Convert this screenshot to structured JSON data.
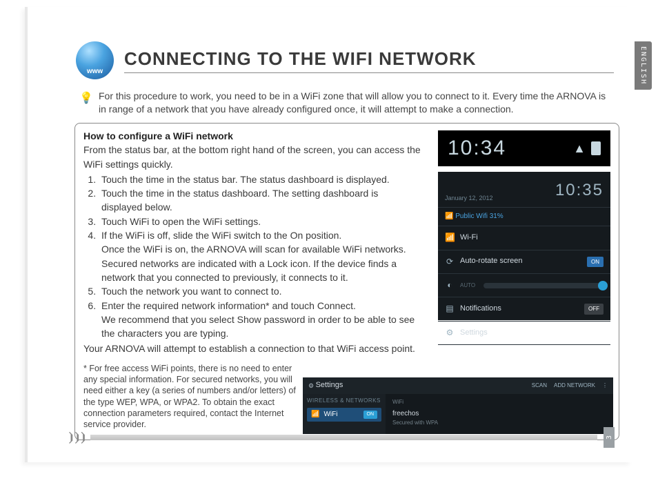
{
  "language_tab": "ENGLISH",
  "header": {
    "globe_label": "www",
    "title": "CONNECTING TO THE WIFI NETWORK"
  },
  "intro": "For this procedure to work, you need to be in a WiFi zone that will allow you to connect to it. Every time the ARNOVA is in range of a network that you have already configured once, it will attempt to make a connection.",
  "config": {
    "heading": "How to configure a WiFi network",
    "lead": "From the status bar, at the bottom right hand of the screen, you can access the WiFi settings quickly.",
    "steps": {
      "s1": "Touch the time in the status bar. The status dashboard is displayed.",
      "s2": "Touch the time in the status dashboard. The setting dashboard is displayed below.",
      "s3": "Touch WiFi to open the WiFi settings.",
      "s4": "If the WiFi is off, slide the WiFi switch to the On position.",
      "s4a": "Once the WiFi is on, the ARNOVA will scan for available WiFi networks.",
      "s4b": "Secured networks are indicated with a Lock icon. If the device finds a network that you connected to previously, it connects to it.",
      "s5": "Touch the network you want to connect to.",
      "s6": "Enter the required network information* and touch Connect.",
      "s6a": "We recommend that you select Show password in order to be able to see the characters you are typing."
    },
    "closing": "Your ARNOVA will attempt to establish a connection to that WiFi access point.",
    "footnote": "* For free access WiFi points, there is no need to enter any special information. For secured networks, you will need either a key (a series of numbers and/or letters) of the type WEP, WPA, or WPA2. To obtain the exact connection parameters required, contact the Internet service provider."
  },
  "shot1": {
    "time": "10:34"
  },
  "shot2": {
    "date": "January 12, 2012",
    "time": "10:35",
    "public": "Public Wifi   31%",
    "rows": {
      "wifi": "Wi-Fi",
      "rotate": "Auto-rotate screen",
      "bright": "AUTO",
      "notif": "Notifications",
      "settings": "Settings",
      "on": "ON",
      "off": "OFF"
    }
  },
  "shot3": {
    "title": "Settings",
    "scan": "SCAN",
    "add": "ADD NETWORK",
    "section": "WIRELESS & NETWORKS",
    "wifi": "WiFi",
    "on": "ON",
    "panel_label": "WiFi",
    "net_name": "freechos",
    "net_sub": "Secured with WPA"
  },
  "page_number": "3"
}
